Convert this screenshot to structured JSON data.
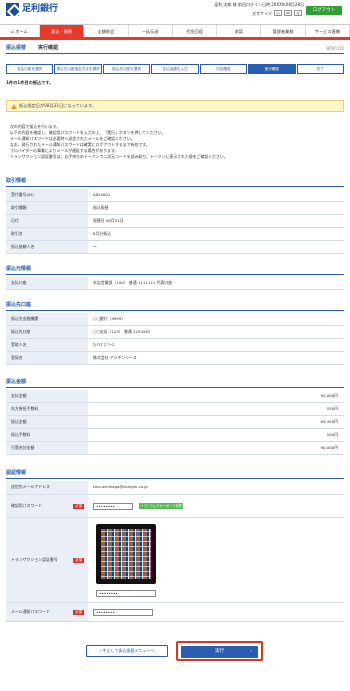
{
  "header": {
    "bank_name": "足利銀行",
    "user": "足利 太郎 様",
    "last_login": "前回ログイン日時 20XX年08月28日",
    "font_size_label": "文字サイズ",
    "font_options": [
      "小",
      "中",
      "大"
    ],
    "logout": "ログアウト"
  },
  "nav": [
    "ホーム",
    "振込・振替",
    "全額照会",
    "一括伝送",
    "代金回収",
    "承認",
    "管理者業務",
    "サービス連携"
  ],
  "page": {
    "section": "振込振替",
    "title": "実行確認",
    "code": "BFKF013"
  },
  "steps": [
    "支払口座を選択",
    "振込先口座指定方法を選択",
    "振込先口座を選択",
    "支払金額を入力",
    "内容確認",
    "実行確認",
    "完了"
  ],
  "current_step": 5,
  "notice": "1件の1件目の振込です。",
  "warning": "振込指定日が08月31日になっています。",
  "intro": [
    "次の内容で振込を行います。",
    "以下の内容を確認し、確認用パスワードを入力の上、「実行」ボタンを押してください。",
    "メール通知パスワードは必要時へ送信されたメールをご確認ください。",
    "なお、発行されたメール通知パスワードは確実にログアウトするまで有効です。",
    "ブロバイダーの事業によりメールが遅延する場合があります。",
    "トランザクション認証番号は、お手持ちのトークンで二次元コードを読み取り、トークンに表示された値をご確認ください。"
  ],
  "sections": {
    "torihiki": {
      "title": "取引情報",
      "rows": [
        {
          "k": "受付番号(ID)",
          "v": "0824001"
        },
        {
          "k": "取引種類",
          "v": "振込振替"
        },
        {
          "k": "日付",
          "v": "振替日 08月31日"
        },
        {
          "k": "取引名",
          "v": "8月分振込"
        },
        {
          "k": "振込依頼人名",
          "v": "ー"
        }
      ]
    },
    "moto": {
      "title": "振込元情報",
      "rows": [
        {
          "k": "支払口座",
          "v": "本店営業部（100） 普通 1111111 代表口座"
        }
      ]
    },
    "saki": {
      "title": "振込先口座",
      "rows": [
        {
          "k": "振込先金融機関",
          "v": "○○銀行（9999）"
        },
        {
          "k": "振込先口座",
          "v": "○○支店（123） 普通 1234567"
        },
        {
          "k": "受取人名",
          "v": "ｶ)ｱｼｶﾞｶﾞﾘｰｽ"
        },
        {
          "k": "登録名",
          "v": "株式会社 アシギンリース"
        }
      ]
    },
    "kingaku": {
      "title": "振込金額",
      "rows": [
        {
          "k": "支払金額",
          "v": "90,000円"
        },
        {
          "k": "先方負担手数料",
          "v": "550円"
        },
        {
          "k": "振込金額",
          "v": "89,450円"
        },
        {
          "k": "振込手数料",
          "v": "550円"
        },
        {
          "k": "引落合計金額",
          "v": "90,000円"
        }
      ]
    },
    "ninsho": {
      "title": "認証情報",
      "email_label": "送信先メールアドレス",
      "email": "taro.ashikaga@ashigin.co.jp",
      "pw_label": "確認用パスワード",
      "pw_value": "••••••••",
      "sw_kbd": "ソフトウェアキーボードを開く",
      "tx_label": "トランザクション認証番号",
      "tx_value": "••••••••",
      "mail_pw_label": "メール通知パスワード",
      "mail_pw_value": "••••••••",
      "required": "必須"
    }
  },
  "buttons": {
    "back": "中止して振込振替メニューへ",
    "execute": "実行"
  }
}
